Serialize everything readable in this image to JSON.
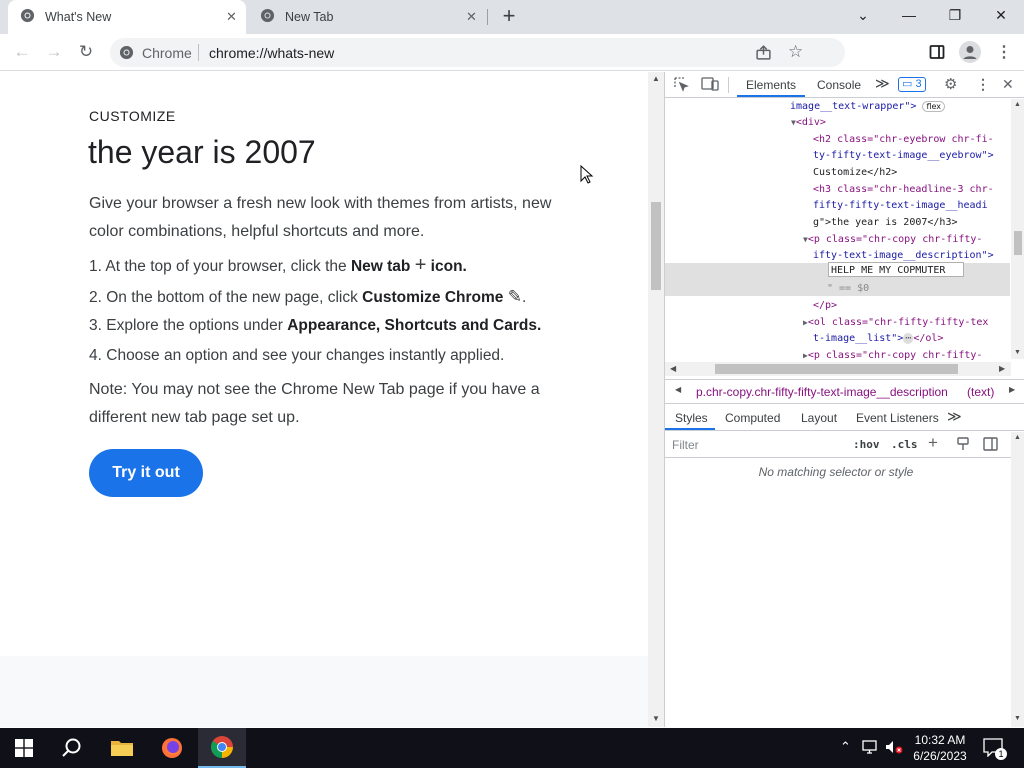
{
  "tabs": [
    {
      "title": "What's New",
      "active": true
    },
    {
      "title": "New Tab",
      "active": false
    }
  ],
  "window_controls": {
    "minimize": "—",
    "restore": "❐",
    "close": "✕",
    "tab_search": "⌄"
  },
  "toolbar": {
    "back": "←",
    "forward": "→",
    "reload": "↻",
    "site_label": "Chrome",
    "url": "chrome://whats-new"
  },
  "page": {
    "eyebrow": "CUSTOMIZE",
    "headline": "the year is 2007",
    "description": "Give your browser a fresh new look with themes from artists, new color combinations, helpful shortcuts and more.",
    "steps": [
      {
        "num": "1.",
        "pre": "At the top of your browser, click the ",
        "bold": "New tab",
        "icon": "+",
        "bold2": " icon.",
        "post": ""
      },
      {
        "num": "2.",
        "pre": "On the bottom of the new page, click ",
        "bold": "Customize Chrome",
        "icon": "✎",
        "bold2": "",
        "post": "."
      },
      {
        "num": "3.",
        "pre": "Explore the options under ",
        "bold": "Appearance, Shortcuts and Cards.",
        "icon": "",
        "bold2": "",
        "post": ""
      },
      {
        "num": "4.",
        "pre": "Choose an option and see your changes instantly applied.",
        "bold": "",
        "icon": "",
        "bold2": "",
        "post": ""
      }
    ],
    "note": "Note: You may not see the Chrome New Tab page if you have a different new tab page set up.",
    "cta": "Try it out"
  },
  "devtools": {
    "tabs": {
      "elements": "Elements",
      "console": "Console",
      "more": "≫",
      "issues_count": "3"
    },
    "dom_lines": {
      "l0a": "image__text-wrapper\">",
      "l0b": "flex",
      "l1": "<div>",
      "l2a": "<h2 class=\"chr-eyebrow chr-fi-",
      "l2b": "ty-fifty-text-image__eyebrow\">",
      "l2c": "Customize</h2>",
      "l3a": "<h3 class=\"chr-headline-3 chr-",
      "l3b": "fifty-fifty-text-image__headi",
      "l3c": "g\">the year is 2007</h3>",
      "l4a": "<p class=\"chr-copy chr-fifty-",
      "l4b": "ifty-text-image__description\">",
      "l5": "HELP ME MY COPMUTER",
      "l6": "\" == $0",
      "l7": "</p>",
      "l8a": "<ol class=\"chr-fifty-fifty-tex",
      "l8b": "t-image__list\">",
      "l8c": "</ol>",
      "l9": "<p class=\"chr-copy chr-fifty-"
    },
    "breadcrumb": "p.chr-copy.chr-fifty-fifty-text-image__description",
    "breadcrumb_tail": "(text)",
    "styles_tabs": {
      "styles": "Styles",
      "computed": "Computed",
      "layout": "Layout",
      "listeners": "Event Listeners",
      "more": "≫"
    },
    "filter_placeholder": "Filter",
    "hov": ":hov",
    "cls": ".cls",
    "no_match": "No matching selector or style"
  },
  "taskbar": {
    "time": "10:32 AM",
    "date": "6/26/2023",
    "notif_count": "1"
  },
  "colors": {
    "accent": "#1a73e8",
    "taskbar": "#101018",
    "tabstrip": "#dee1e6"
  }
}
